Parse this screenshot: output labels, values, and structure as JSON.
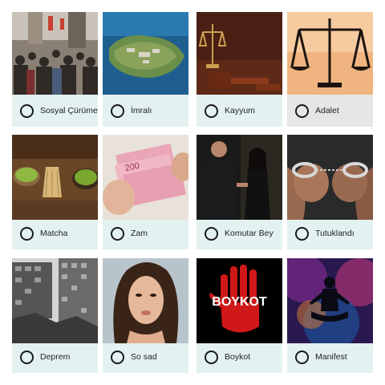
{
  "cards": [
    {
      "label": "Sosyal Çürüme",
      "image": "crowd-street-photo"
    },
    {
      "label": "İmralı",
      "image": "island-aerial-photo"
    },
    {
      "label": "Kayyum",
      "image": "gavel-and-scales-photo"
    },
    {
      "label": "Adalet",
      "image": "scales-of-justice-photo"
    },
    {
      "label": "Matcha",
      "image": "matcha-tea-photo"
    },
    {
      "label": "Zam",
      "image": "money-banknotes-photo"
    },
    {
      "label": "Komutar Bey",
      "image": "couple-talking-photo"
    },
    {
      "label": "Tutuklandı",
      "image": "handcuffs-photo"
    },
    {
      "label": "Deprem",
      "image": "earthquake-ruins-photo"
    },
    {
      "label": "So sad",
      "image": "woman-portrait-photo"
    },
    {
      "label": "Boykot",
      "image": "boykot-hand-graphic",
      "image_text": "BOYKOT"
    },
    {
      "label": "Manifest",
      "image": "meditation-cosmos-graphic"
    }
  ],
  "colors": {
    "card_bg": "#e3f1f1",
    "card_bg_selected": "#e6e6e6",
    "radio_border": "#1a1a1a"
  }
}
